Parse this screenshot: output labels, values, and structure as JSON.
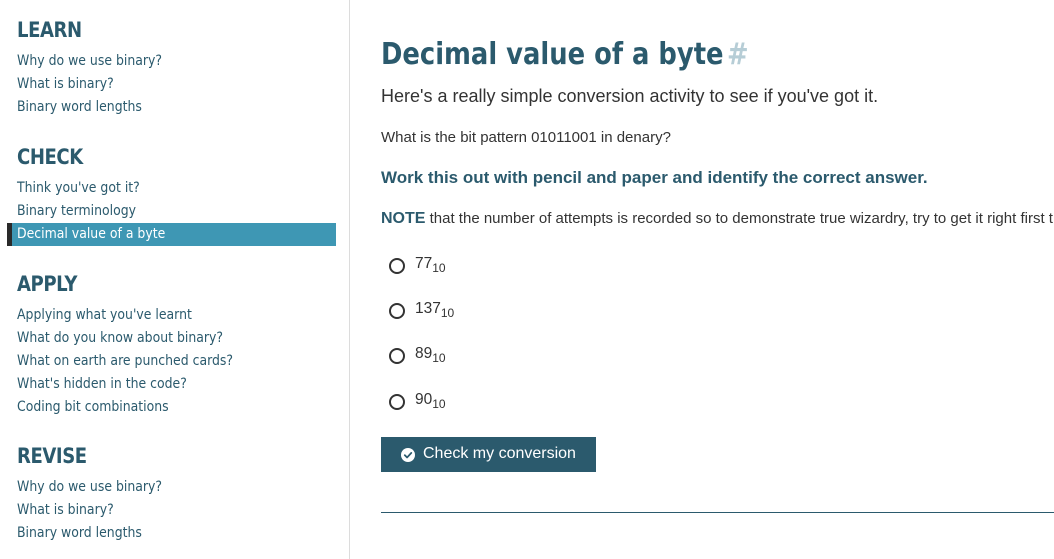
{
  "sidebar": {
    "sections": [
      {
        "heading": "LEARN",
        "items": [
          "Why do we use binary?",
          "What is binary?",
          "Binary word lengths"
        ]
      },
      {
        "heading": "CHECK",
        "items": [
          "Think you've got it?",
          "Binary terminology",
          "Decimal value of a byte"
        ]
      },
      {
        "heading": "APPLY",
        "items": [
          "Applying what you've learnt",
          "What do you know about binary?",
          "What on earth are punched cards?",
          "What's hidden in the code?",
          "Coding bit combinations"
        ]
      },
      {
        "heading": "REVISE",
        "items": [
          "Why do we use binary?",
          "What is binary?",
          "Binary word lengths"
        ]
      }
    ],
    "active_item": "Decimal value of a byte"
  },
  "main": {
    "title": "Decimal value of a byte",
    "title_anchor": "#",
    "intro": "Here's a really simple conversion activity to see if you've got it.",
    "question": "What is the bit pattern 01011001 in denary?",
    "instruction": "Work this out with pencil and paper and identify the correct answer.",
    "note_label": "NOTE",
    "note_text": " that the number of attempts is recorded so to demonstrate true wizardry, try to get it right first time.",
    "options": [
      {
        "value": "77",
        "base": "10"
      },
      {
        "value": "137",
        "base": "10"
      },
      {
        "value": "89",
        "base": "10"
      },
      {
        "value": "90",
        "base": "10"
      }
    ],
    "check_button_label": "Check my conversion"
  },
  "colors": {
    "heading": "#2b5a6d",
    "active_bg": "#3e97b4",
    "button_bg": "#2b5a6d",
    "anchor": "#b6cdd6"
  },
  "icons": {
    "button_icon": "check-circle-icon"
  }
}
